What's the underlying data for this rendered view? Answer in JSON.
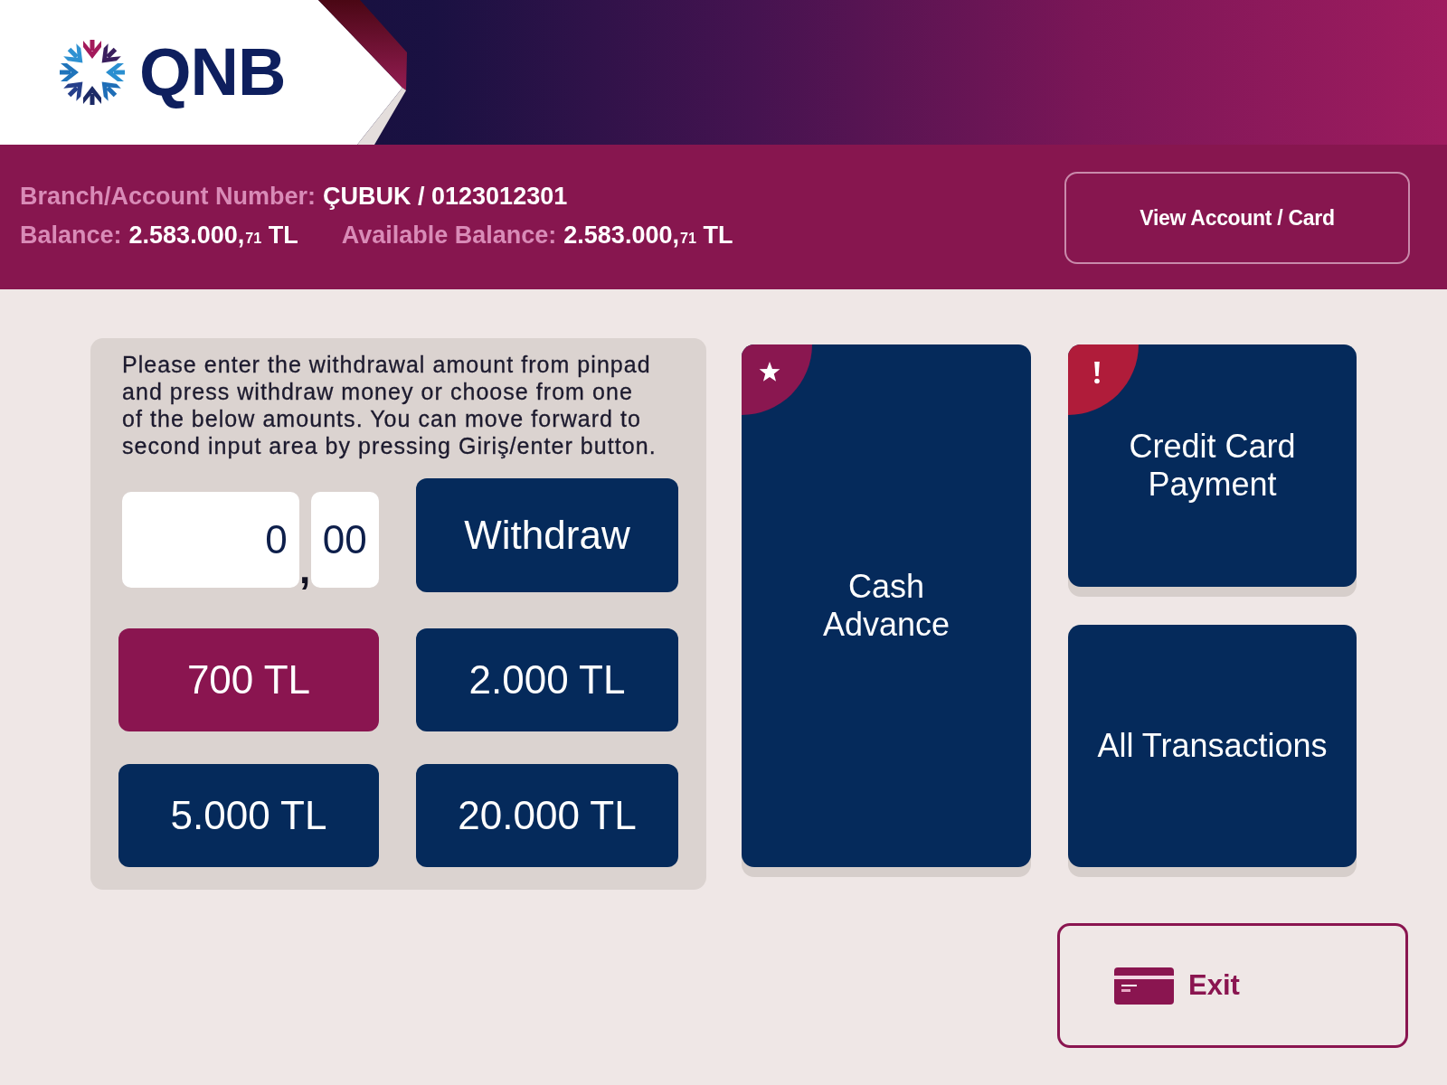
{
  "header": {
    "logo_text": "QNB"
  },
  "account": {
    "rows": [
      {
        "fields": [
          {
            "label": "Branch/Account Number:",
            "value": "ÇUBUK / 0123012301"
          }
        ]
      },
      {
        "fields": [
          {
            "label": "Balance:",
            "value": "2.583.000,$_{71}$ TL"
          },
          {
            "label": "Available Balance:",
            "value": "2.583.000,$_{71}$ TL"
          }
        ]
      }
    ],
    "view_button": "View Account / Card"
  },
  "withdrawal": {
    "instructions": "Please enter the withdrawal amount from pinpad and press withdraw money or choose from one of the below amounts. You can move forward to second input area by pressing Giriş/enter button.",
    "amount": {
      "integer": "0",
      "separator": ",",
      "decimals": "00"
    },
    "withdraw_button": "Withdraw",
    "quick_amounts": [
      {
        "label": "700 TL",
        "selected": true
      },
      {
        "label": "2.000 TL",
        "selected": false
      },
      {
        "label": "5.000 TL",
        "selected": false
      },
      {
        "label": "20.000 TL",
        "selected": false
      }
    ]
  },
  "tiles": [
    {
      "label": "Cash\nAdvance",
      "kind": "tall",
      "badge": {
        "kind": "star",
        "color": "#8a1750"
      }
    },
    {
      "label": "Credit Card\nPayment",
      "kind": "standard",
      "badge": {
        "kind": "alert",
        "color": "#b01c3a"
      }
    },
    {
      "label": "All Transactions",
      "kind": "standard"
    }
  ],
  "exit_button": {
    "label": "Exit"
  }
}
